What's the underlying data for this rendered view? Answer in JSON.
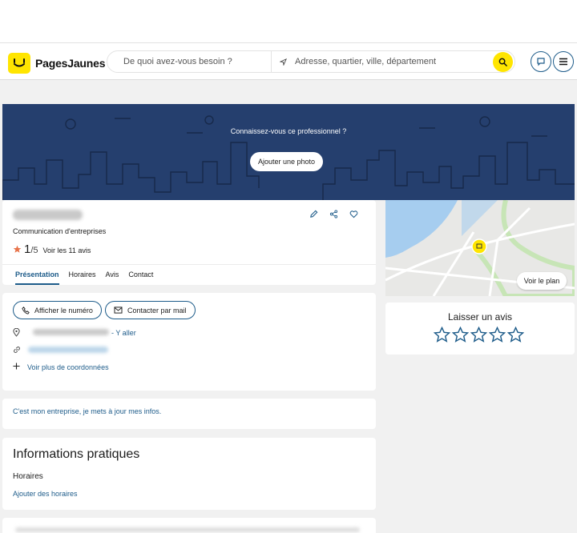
{
  "header": {
    "logo_text": "PagesJaunes",
    "search_what_placeholder": "De quoi avez-vous besoin ?",
    "search_where_placeholder": "Adresse, quartier, ville, département"
  },
  "banner": {
    "title": "Connaissez-vous ce professionnel ?",
    "button": "Ajouter une photo"
  },
  "business": {
    "category": "Communication d'entreprises",
    "rating": "1",
    "rating_max": "/5",
    "reviews_link": "Voir les 11 avis"
  },
  "tabs": [
    "Présentation",
    "Horaires",
    "Avis",
    "Contact"
  ],
  "contact": {
    "phone_button": "Afficher le numéro",
    "mail_button": "Contacter par mail",
    "directions_link": "Y aller",
    "more_link": "Voir plus de coordonnées"
  },
  "map": {
    "button": "Voir le plan"
  },
  "review": {
    "title": "Laisser un avis"
  },
  "claim": {
    "link": "C'est mon entreprise, je mets à jour mes infos."
  },
  "practical": {
    "title": "Informations pratiques",
    "hours_title": "Horaires",
    "hours_link": "Ajouter des horaires"
  },
  "colors": {
    "brand_yellow": "#ffe500",
    "link_blue": "#1e5c8a",
    "banner_blue": "#253f6e",
    "star_orange": "#e8734a"
  }
}
